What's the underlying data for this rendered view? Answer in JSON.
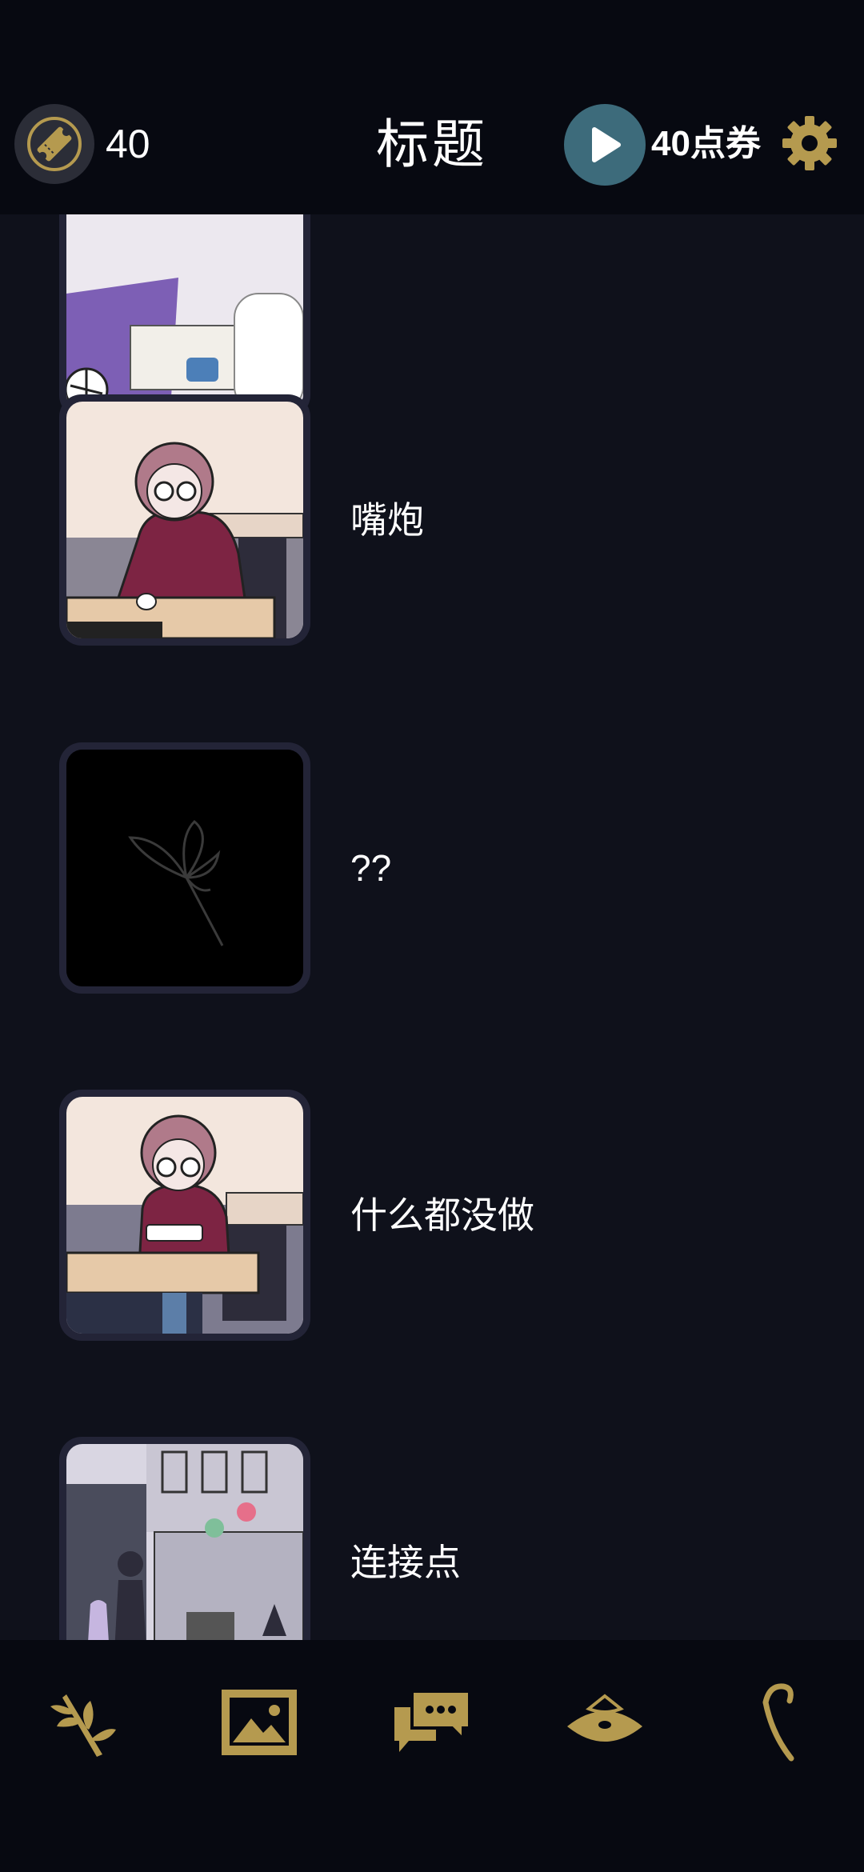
{
  "header": {
    "ticket_count": "40",
    "title": "标题",
    "points_label": "40点券"
  },
  "episodes": [
    {
      "title": ""
    },
    {
      "title": "嘴炮"
    },
    {
      "title": "??"
    },
    {
      "title": "什么都没做"
    },
    {
      "title": "连接点"
    }
  ],
  "nav": {
    "items": [
      "branch-icon",
      "gallery-icon",
      "chat-icon",
      "hat-icon",
      "cane-icon"
    ]
  },
  "colors": {
    "accent_gold": "#b59a4f",
    "play_teal": "#3d6b7b",
    "background": "#0f111b",
    "bar": "#070911"
  }
}
